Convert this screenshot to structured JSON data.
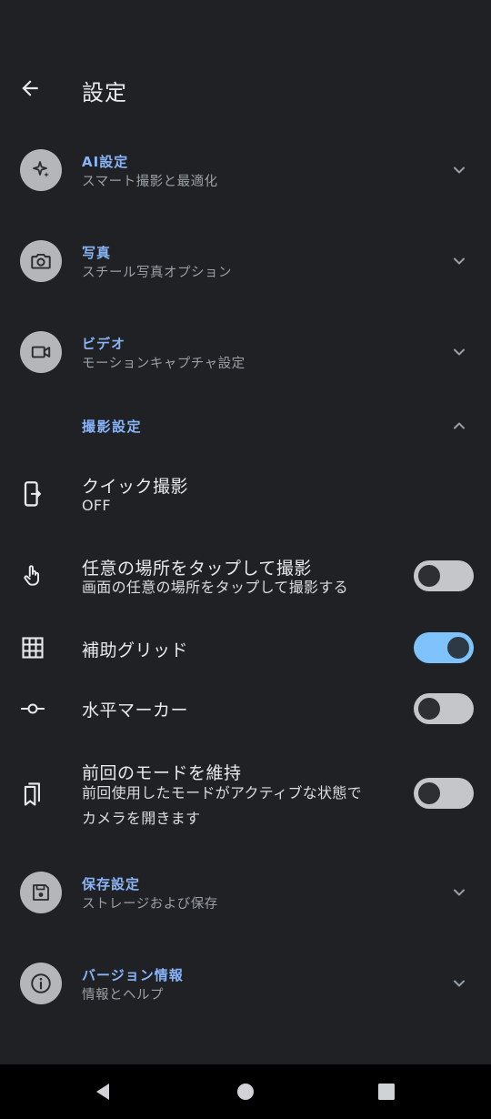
{
  "header": {
    "title": "設定"
  },
  "categories": [
    {
      "title": "AI設定",
      "subtitle": "スマート撮影と最適化",
      "icon": "sparkle-icon"
    },
    {
      "title": "写真",
      "subtitle": "スチール写真オプション",
      "icon": "camera-icon"
    },
    {
      "title": "ビデオ",
      "subtitle": "モーションキャプチャ設定",
      "icon": "video-icon"
    }
  ],
  "section": {
    "title": "撮影設定",
    "expanded": true
  },
  "settings": {
    "quick_shot": {
      "title": "クイック撮影",
      "value": "OFF"
    },
    "tap_anywhere": {
      "title": "任意の場所をタップして撮影",
      "subtitle": "画面の任意の場所をタップして撮影する",
      "enabled": false
    },
    "grid": {
      "title": "補助グリッド",
      "enabled": true
    },
    "level": {
      "title": "水平マーカー",
      "enabled": false
    },
    "keep_mode": {
      "title": "前回のモードを維持",
      "subtitle_line1": "前回使用したモードがアクティブな状態で",
      "subtitle_line2": "カメラを開きます",
      "enabled": false
    }
  },
  "bottom_categories": [
    {
      "title": "保存設定",
      "subtitle": "ストレージおよび保存",
      "icon": "save-icon"
    },
    {
      "title": "バージョン情報",
      "subtitle": "情報とヘルプ",
      "icon": "info-icon"
    }
  ],
  "colors": {
    "accent": "#8ab4f8",
    "toggle_on": "#7ec3fb",
    "background": "#1f2124"
  }
}
